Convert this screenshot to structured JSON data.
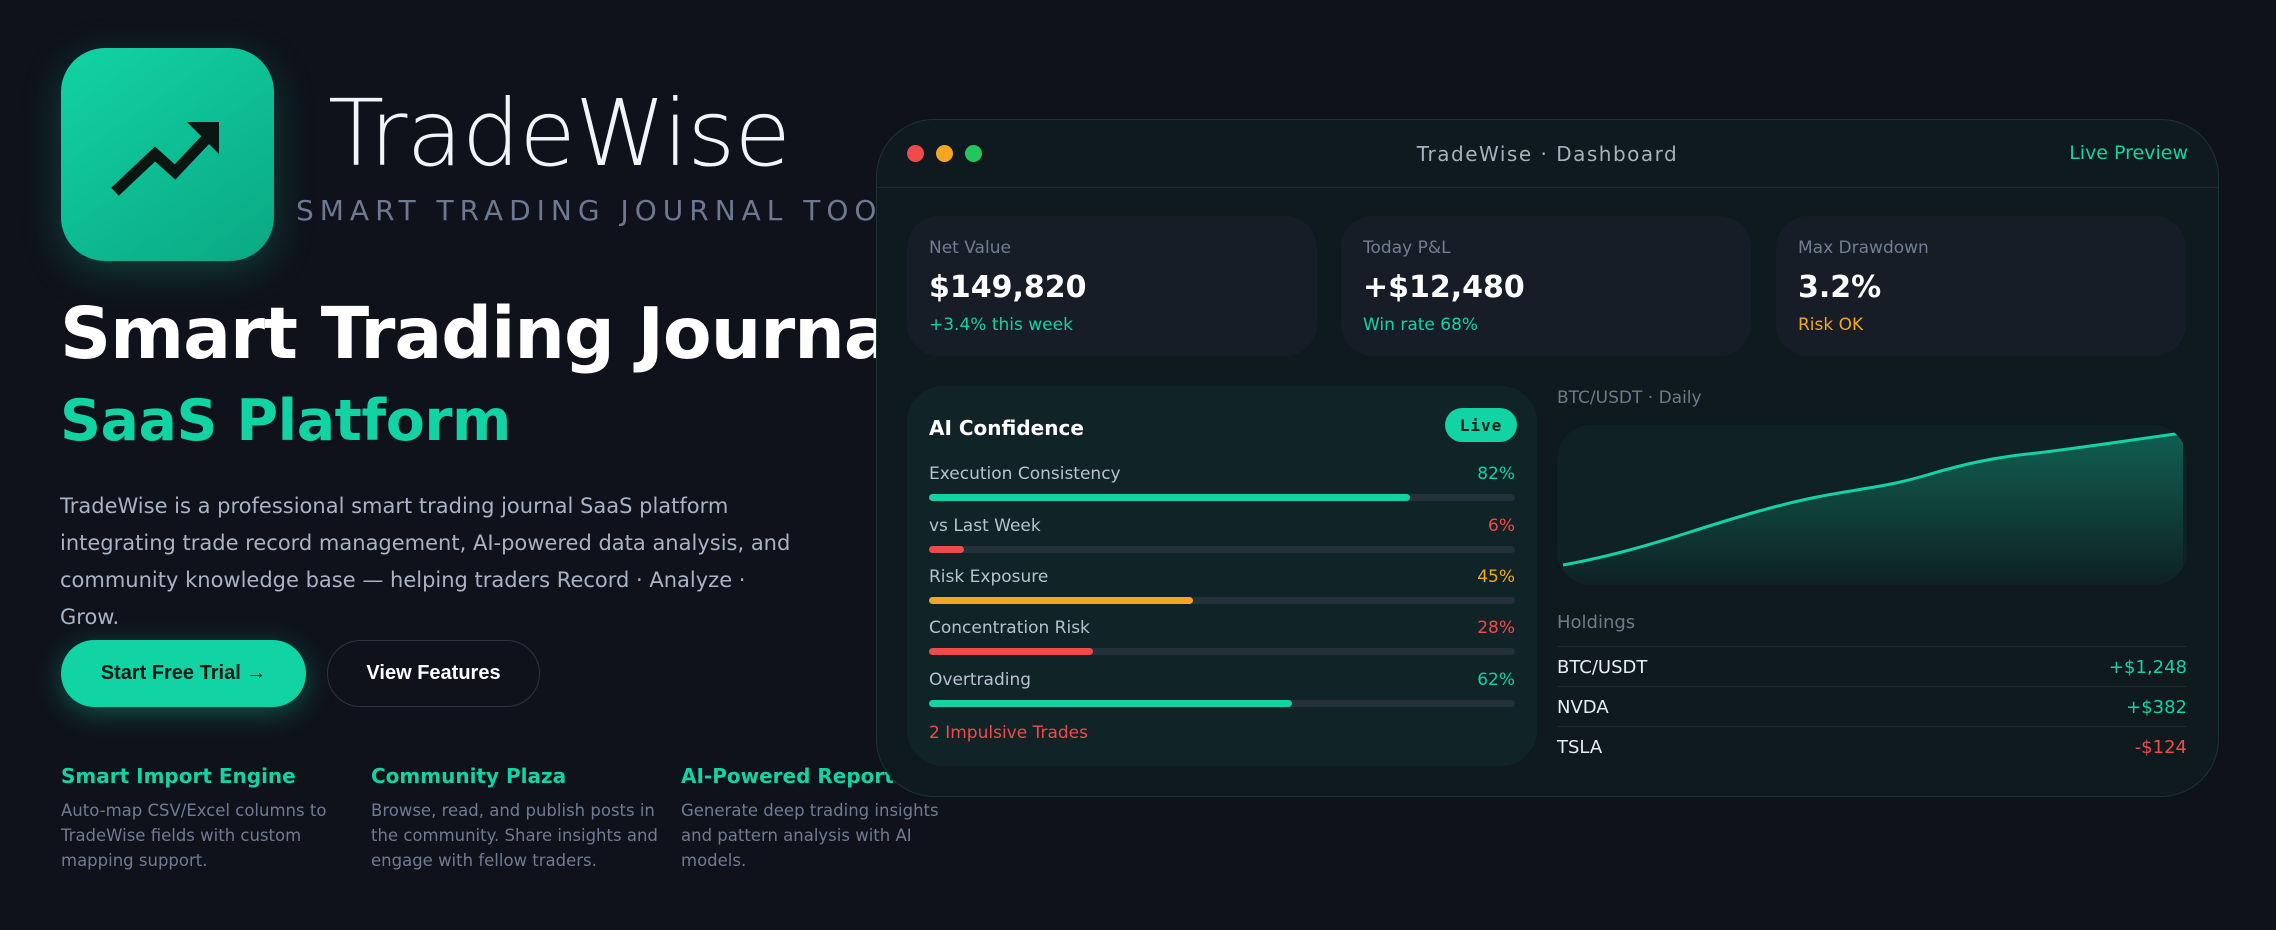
{
  "brand": {
    "name": "TradeWise",
    "tagline": "SMART TRADING JOURNAL TOOL",
    "accent": "#12d3a4"
  },
  "hero": {
    "title_line1": "Smart Trading Journal",
    "title_line2": "SaaS Platform",
    "description": "TradeWise is a professional smart trading journal SaaS platform integrating trade record management, AI-powered data analysis, and community knowledge base — helping traders Record · Analyze · Grow.",
    "primary_cta": "Start Free Trial →",
    "secondary_cta": "View Features"
  },
  "features": [
    {
      "title": "Smart Import Engine",
      "desc": "Auto-map CSV/Excel columns to TradeWise fields with custom mapping support."
    },
    {
      "title": "Community Plaza",
      "desc": "Browse, read, and publish posts in the community. Share insights and engage with fellow traders."
    },
    {
      "title": "AI-Powered Reports",
      "desc": "Generate deep trading insights and pattern analysis with AI models."
    }
  ],
  "dashboard": {
    "window_title": "TradeWise · Dashboard",
    "live_preview": "Live Preview",
    "stats": [
      {
        "label": "Net Value",
        "value": "$149,820",
        "sub": "+3.4% this week",
        "sub_color": "#12d3a4"
      },
      {
        "label": "Today P&L",
        "value": "+$12,480",
        "sub": "Win rate 68%",
        "sub_color": "#12d3a4"
      },
      {
        "label": "Max Drawdown",
        "value": "3.2%",
        "sub": "Risk OK",
        "sub_color": "#f5a524"
      }
    ],
    "ai": {
      "title": "AI Confidence",
      "badge": "Live",
      "metrics": [
        {
          "label": "Execution Consistency",
          "value": "82%",
          "level": 0.82,
          "color": "#12d3a4"
        },
        {
          "label": "vs Last Week",
          "value": "6%",
          "level": 0.06,
          "color": "#f04b4b"
        },
        {
          "label": "Risk Exposure",
          "value": "45%",
          "level": 0.45,
          "color": "#f5a524"
        },
        {
          "label": "Concentration Risk",
          "value": "28%",
          "level": 0.28,
          "color": "#f04b4b"
        },
        {
          "label": "Overtrading",
          "value": "62%",
          "level": 0.62,
          "color": "#12d3a4"
        }
      ],
      "footer": "2 Impulsive Trades"
    },
    "chart_label": "BTC/USDT · Daily",
    "holdings_label": "Holdings",
    "holdings": [
      {
        "symbol": "BTC/USDT",
        "value": "+$1,248",
        "color": "#12d3a4"
      },
      {
        "symbol": "NVDA",
        "value": "+$382",
        "color": "#12d3a4"
      },
      {
        "symbol": "TSLA",
        "value": "-$124",
        "color": "#f04b4b"
      }
    ]
  }
}
